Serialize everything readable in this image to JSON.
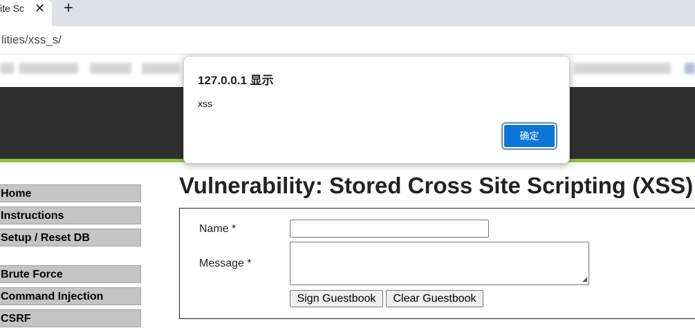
{
  "browser": {
    "tab_title": "ite Sc",
    "close_symbol": "✕",
    "new_tab_symbol": "+",
    "url": "lities/xss_s/"
  },
  "sidebar": {
    "items": [
      {
        "label": "Home"
      },
      {
        "label": "Instructions"
      },
      {
        "label": "Setup / Reset DB"
      },
      {
        "label": "Brute Force"
      },
      {
        "label": "Command Injection"
      },
      {
        "label": "CSRF"
      }
    ]
  },
  "main": {
    "title": "Vulnerability: Stored Cross Site Scripting (XSS)",
    "form": {
      "name_label": "Name *",
      "name_value": "",
      "message_label": "Message *",
      "message_value": "",
      "sign_button": "Sign Guestbook",
      "clear_button": "Clear Guestbook"
    }
  },
  "dialog": {
    "title": "127.0.0.1 显示",
    "message": "xss",
    "ok_label": "确定"
  },
  "colors": {
    "header_bg": "#2f2f2f",
    "accent_green": "#8bc53f",
    "menu_bg": "#c4c4c4",
    "dialog_button": "#0b77d6"
  }
}
